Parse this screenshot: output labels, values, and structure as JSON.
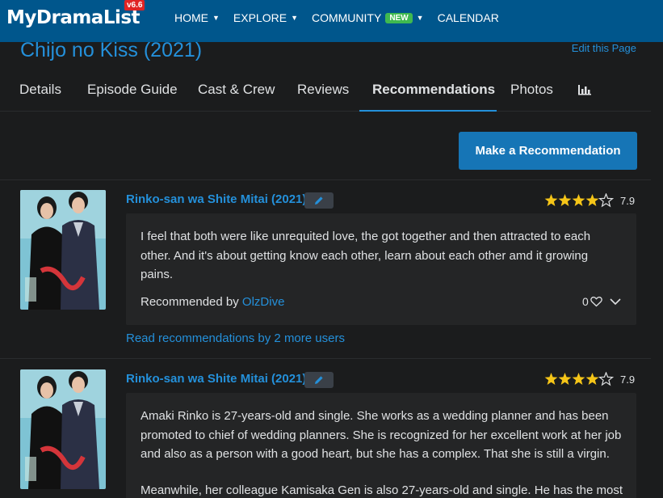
{
  "nav": {
    "logo": "MyDramaList",
    "version": "v6.6",
    "items": [
      {
        "label": "HOME",
        "caret": true
      },
      {
        "label": "EXPLORE",
        "caret": true
      },
      {
        "label": "COMMUNITY",
        "badge": "NEW",
        "caret": true
      },
      {
        "label": "CALENDAR",
        "caret": false
      }
    ]
  },
  "page": {
    "title": "Chijo no Kiss (2021)",
    "edit_link": "Edit this Page"
  },
  "tabs": [
    {
      "label": "Details"
    },
    {
      "label": "Episode Guide"
    },
    {
      "label": "Cast & Crew"
    },
    {
      "label": "Reviews"
    },
    {
      "label": "Recommendations",
      "active": true
    },
    {
      "label": "Photos"
    }
  ],
  "stats_icon": "bar-chart-icon",
  "make_rec_button": "Make a Recommendation",
  "recommendations": [
    {
      "title": "Rinko-san wa Shite Mitai (2021)",
      "rating": "7.9",
      "stars_filled": 4,
      "stars_total": 5,
      "paragraphs": [
        "I feel that both were like unrequited love, the got together and then attracted to each other. And it's about getting know each other, learn about each other amd it growing pains."
      ],
      "recommended_by_label": "Recommended by ",
      "recommended_by_user": "OlzDive",
      "likes": "0",
      "more_link": "Read recommendations by 2 more users"
    },
    {
      "title": "Rinko-san wa Shite Mitai (2021)",
      "rating": "7.9",
      "stars_filled": 4,
      "stars_total": 5,
      "paragraphs": [
        "Amaki Rinko is 27-years-old and single. She works as a wedding planner and has been promoted to chief of wedding planners. She is recognized for her excellent work at her job and also as a person with a good heart, but she has a complex. That she is still a virgin.",
        "Meanwhile, her colleague Kamisaka Gen is also 27-years-old and single. He has the most"
      ]
    }
  ],
  "colors": {
    "nav_bg": "#00568c",
    "page_bg": "#1b1c1d",
    "accent": "#2490da",
    "button": "#1675b6",
    "star": "#f5c518",
    "badge_new": "#3fb950"
  }
}
